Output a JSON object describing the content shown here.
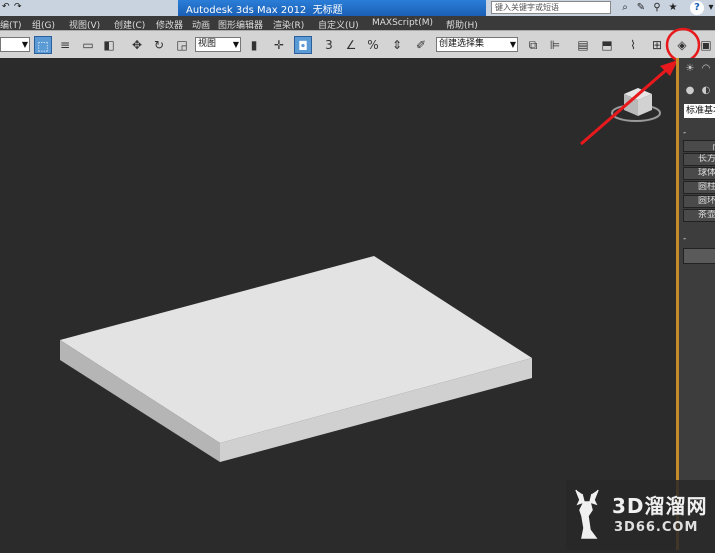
{
  "window": {
    "title": "Autodesk 3ds Max  2012",
    "file_name": "无标题"
  },
  "menu": [
    {
      "label": "编(T)"
    },
    {
      "label": "组(G)"
    },
    {
      "label": "视图(V)"
    },
    {
      "label": "创建(C)"
    },
    {
      "label": "修改器"
    },
    {
      "label": "动画"
    },
    {
      "label": "图形编辑器"
    },
    {
      "label": "渲染(R)"
    },
    {
      "label": "自定义(U)"
    },
    {
      "label": "MAXScript(M)"
    },
    {
      "label": "帮助(H)"
    }
  ],
  "search": {
    "placeholder": "键入关键字或短语"
  },
  "toolbar": {
    "reference_coord": "视图",
    "selection_set": "创建选择集",
    "snap_label": "3",
    "percent_label": "%"
  },
  "command_panel": {
    "category_dropdown": "标准基本体",
    "object_buttons": [
      "长方",
      "球体",
      "圆柱",
      "圆环",
      "茶壶"
    ]
  },
  "annotation": {
    "arrow_color": "#e8191c",
    "highlighted_tool": "render-setup-icon"
  },
  "watermark": {
    "main": "3D溜溜网",
    "sub": "3D66.COM"
  },
  "colors": {
    "viewport_bg": "#2b2b2b",
    "active_border": "#c58a2a",
    "highlight_blue": "#5b9bd5"
  }
}
